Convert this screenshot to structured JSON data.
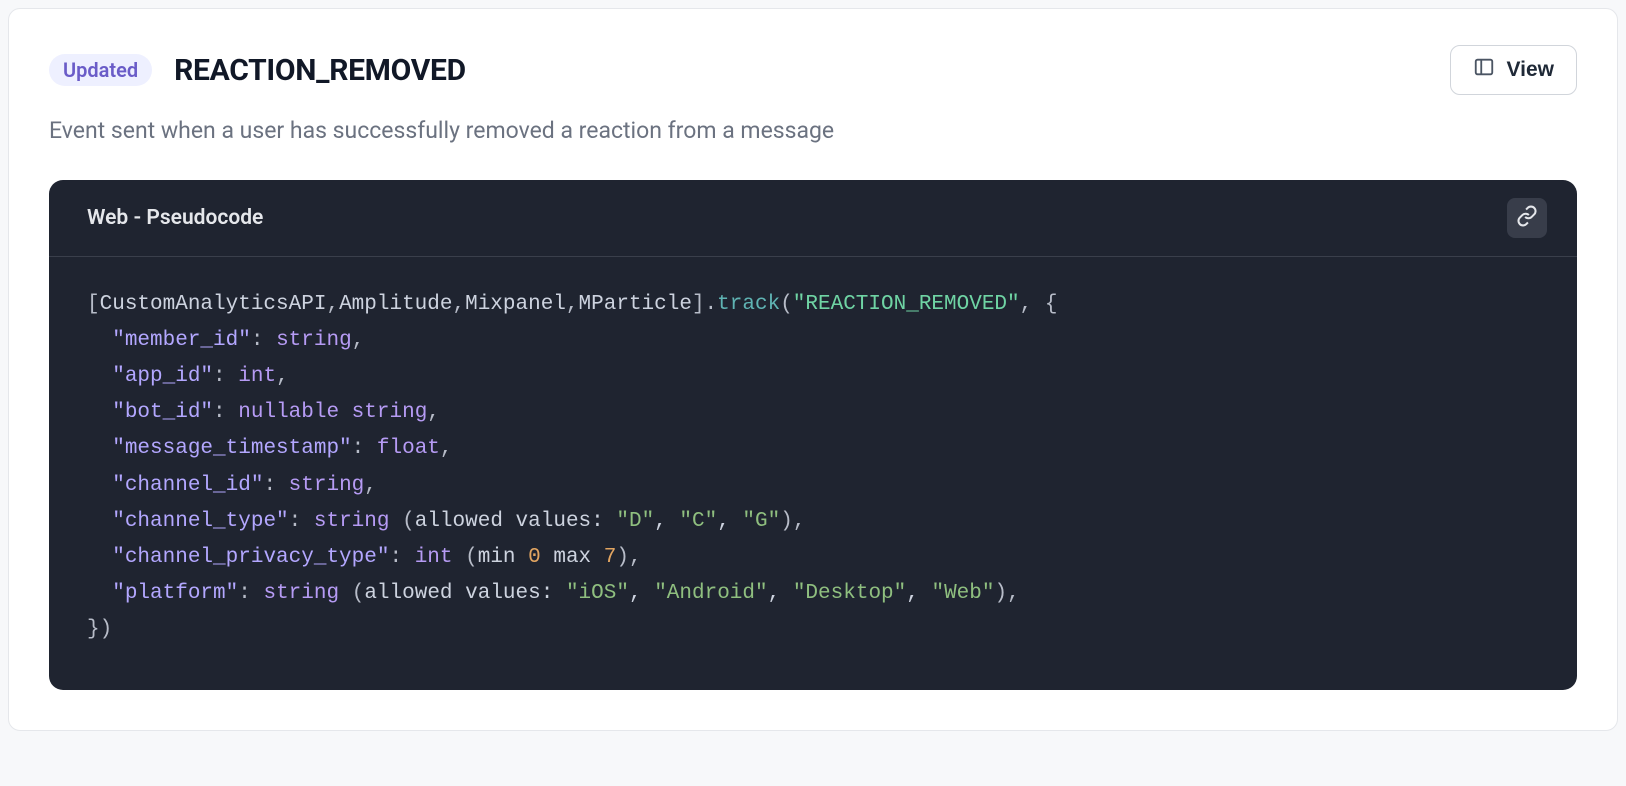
{
  "header": {
    "badge": "Updated",
    "title": "REACTION_REMOVED",
    "view_label": "View"
  },
  "description": "Event sent when a user has successfully removed a reaction from a message",
  "code_panel": {
    "title": "Web - Pseudocode"
  },
  "pseudocode": {
    "providers": [
      "CustomAnalyticsAPI",
      "Amplitude",
      "Mixpanel",
      "MParticle"
    ],
    "method": "track",
    "event_name": "REACTION_REMOVED",
    "properties": [
      {
        "key": "member_id",
        "type": "string",
        "note": ""
      },
      {
        "key": "app_id",
        "type": "int",
        "note": ""
      },
      {
        "key": "bot_id",
        "type": "nullable string",
        "note": ""
      },
      {
        "key": "message_timestamp",
        "type": "float",
        "note": ""
      },
      {
        "key": "channel_id",
        "type": "string",
        "note": ""
      },
      {
        "key": "channel_type",
        "type": "string",
        "note": "(allowed values: \"D\", \"C\", \"G\")"
      },
      {
        "key": "channel_privacy_type",
        "type": "int",
        "note": "(min 0 max 7)"
      },
      {
        "key": "platform",
        "type": "string",
        "note": "(allowed values: \"iOS\", \"Android\", \"Desktop\", \"Web\")"
      }
    ]
  }
}
